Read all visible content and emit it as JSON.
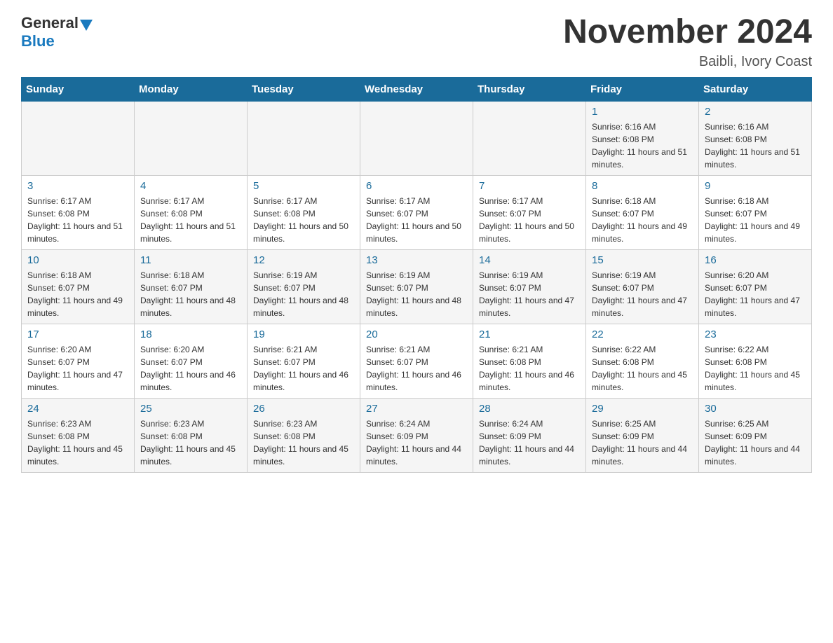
{
  "logo": {
    "general": "General",
    "blue": "Blue"
  },
  "header": {
    "month_year": "November 2024",
    "location": "Baibli, Ivory Coast"
  },
  "days_of_week": [
    "Sunday",
    "Monday",
    "Tuesday",
    "Wednesday",
    "Thursday",
    "Friday",
    "Saturday"
  ],
  "weeks": [
    [
      {
        "day": "",
        "info": ""
      },
      {
        "day": "",
        "info": ""
      },
      {
        "day": "",
        "info": ""
      },
      {
        "day": "",
        "info": ""
      },
      {
        "day": "",
        "info": ""
      },
      {
        "day": "1",
        "info": "Sunrise: 6:16 AM\nSunset: 6:08 PM\nDaylight: 11 hours and 51 minutes."
      },
      {
        "day": "2",
        "info": "Sunrise: 6:16 AM\nSunset: 6:08 PM\nDaylight: 11 hours and 51 minutes."
      }
    ],
    [
      {
        "day": "3",
        "info": "Sunrise: 6:17 AM\nSunset: 6:08 PM\nDaylight: 11 hours and 51 minutes."
      },
      {
        "day": "4",
        "info": "Sunrise: 6:17 AM\nSunset: 6:08 PM\nDaylight: 11 hours and 51 minutes."
      },
      {
        "day": "5",
        "info": "Sunrise: 6:17 AM\nSunset: 6:08 PM\nDaylight: 11 hours and 50 minutes."
      },
      {
        "day": "6",
        "info": "Sunrise: 6:17 AM\nSunset: 6:07 PM\nDaylight: 11 hours and 50 minutes."
      },
      {
        "day": "7",
        "info": "Sunrise: 6:17 AM\nSunset: 6:07 PM\nDaylight: 11 hours and 50 minutes."
      },
      {
        "day": "8",
        "info": "Sunrise: 6:18 AM\nSunset: 6:07 PM\nDaylight: 11 hours and 49 minutes."
      },
      {
        "day": "9",
        "info": "Sunrise: 6:18 AM\nSunset: 6:07 PM\nDaylight: 11 hours and 49 minutes."
      }
    ],
    [
      {
        "day": "10",
        "info": "Sunrise: 6:18 AM\nSunset: 6:07 PM\nDaylight: 11 hours and 49 minutes."
      },
      {
        "day": "11",
        "info": "Sunrise: 6:18 AM\nSunset: 6:07 PM\nDaylight: 11 hours and 48 minutes."
      },
      {
        "day": "12",
        "info": "Sunrise: 6:19 AM\nSunset: 6:07 PM\nDaylight: 11 hours and 48 minutes."
      },
      {
        "day": "13",
        "info": "Sunrise: 6:19 AM\nSunset: 6:07 PM\nDaylight: 11 hours and 48 minutes."
      },
      {
        "day": "14",
        "info": "Sunrise: 6:19 AM\nSunset: 6:07 PM\nDaylight: 11 hours and 47 minutes."
      },
      {
        "day": "15",
        "info": "Sunrise: 6:19 AM\nSunset: 6:07 PM\nDaylight: 11 hours and 47 minutes."
      },
      {
        "day": "16",
        "info": "Sunrise: 6:20 AM\nSunset: 6:07 PM\nDaylight: 11 hours and 47 minutes."
      }
    ],
    [
      {
        "day": "17",
        "info": "Sunrise: 6:20 AM\nSunset: 6:07 PM\nDaylight: 11 hours and 47 minutes."
      },
      {
        "day": "18",
        "info": "Sunrise: 6:20 AM\nSunset: 6:07 PM\nDaylight: 11 hours and 46 minutes."
      },
      {
        "day": "19",
        "info": "Sunrise: 6:21 AM\nSunset: 6:07 PM\nDaylight: 11 hours and 46 minutes."
      },
      {
        "day": "20",
        "info": "Sunrise: 6:21 AM\nSunset: 6:07 PM\nDaylight: 11 hours and 46 minutes."
      },
      {
        "day": "21",
        "info": "Sunrise: 6:21 AM\nSunset: 6:08 PM\nDaylight: 11 hours and 46 minutes."
      },
      {
        "day": "22",
        "info": "Sunrise: 6:22 AM\nSunset: 6:08 PM\nDaylight: 11 hours and 45 minutes."
      },
      {
        "day": "23",
        "info": "Sunrise: 6:22 AM\nSunset: 6:08 PM\nDaylight: 11 hours and 45 minutes."
      }
    ],
    [
      {
        "day": "24",
        "info": "Sunrise: 6:23 AM\nSunset: 6:08 PM\nDaylight: 11 hours and 45 minutes."
      },
      {
        "day": "25",
        "info": "Sunrise: 6:23 AM\nSunset: 6:08 PM\nDaylight: 11 hours and 45 minutes."
      },
      {
        "day": "26",
        "info": "Sunrise: 6:23 AM\nSunset: 6:08 PM\nDaylight: 11 hours and 45 minutes."
      },
      {
        "day": "27",
        "info": "Sunrise: 6:24 AM\nSunset: 6:09 PM\nDaylight: 11 hours and 44 minutes."
      },
      {
        "day": "28",
        "info": "Sunrise: 6:24 AM\nSunset: 6:09 PM\nDaylight: 11 hours and 44 minutes."
      },
      {
        "day": "29",
        "info": "Sunrise: 6:25 AM\nSunset: 6:09 PM\nDaylight: 11 hours and 44 minutes."
      },
      {
        "day": "30",
        "info": "Sunrise: 6:25 AM\nSunset: 6:09 PM\nDaylight: 11 hours and 44 minutes."
      }
    ]
  ]
}
